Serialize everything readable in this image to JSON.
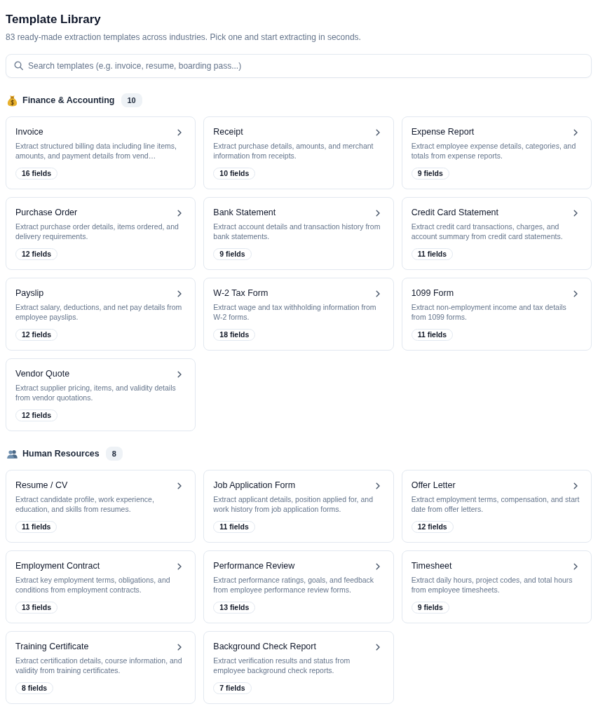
{
  "page": {
    "title": "Template Library",
    "subtitle": "83 ready-made extraction templates across industries. Pick one and start extracting in seconds."
  },
  "search": {
    "placeholder": "Search templates (e.g. invoice, resume, boarding pass...)"
  },
  "sections": [
    {
      "kind": "finance",
      "title": "Finance & Accounting",
      "count": "10",
      "templates": [
        {
          "title": "Invoice",
          "description": "Extract structured billing data including line items, amounts, and payment details from vend…",
          "fields": "16 fields"
        },
        {
          "title": "Receipt",
          "description": "Extract purchase details, amounts, and merchant information from receipts.",
          "fields": "10 fields"
        },
        {
          "title": "Expense Report",
          "description": "Extract employee expense details, categories, and totals from expense reports.",
          "fields": "9 fields"
        },
        {
          "title": "Purchase Order",
          "description": "Extract purchase order details, items ordered, and delivery requirements.",
          "fields": "12 fields"
        },
        {
          "title": "Bank Statement",
          "description": "Extract account details and transaction history from bank statements.",
          "fields": "9 fields"
        },
        {
          "title": "Credit Card Statement",
          "description": "Extract credit card transactions, charges, and account summary from credit card statements.",
          "fields": "11 fields"
        },
        {
          "title": "Payslip",
          "description": "Extract salary, deductions, and net pay details from employee payslips.",
          "fields": "12 fields"
        },
        {
          "title": "W-2 Tax Form",
          "description": "Extract wage and tax withholding information from W-2 forms.",
          "fields": "18 fields"
        },
        {
          "title": "1099 Form",
          "description": "Extract non-employment income and tax details from 1099 forms.",
          "fields": "11 fields"
        },
        {
          "title": "Vendor Quote",
          "description": "Extract supplier pricing, items, and validity details from vendor quotations.",
          "fields": "12 fields"
        }
      ]
    },
    {
      "kind": "people",
      "title": "Human Resources",
      "count": "8",
      "templates": [
        {
          "title": "Resume / CV",
          "description": "Extract candidate profile, work experience, education, and skills from resumes.",
          "fields": "11 fields"
        },
        {
          "title": "Job Application Form",
          "description": "Extract applicant details, position applied for, and work history from job application forms.",
          "fields": "11 fields"
        },
        {
          "title": "Offer Letter",
          "description": "Extract employment terms, compensation, and start date from offer letters.",
          "fields": "12 fields"
        },
        {
          "title": "Employment Contract",
          "description": "Extract key employment terms, obligations, and conditions from employment contracts.",
          "fields": "13 fields"
        },
        {
          "title": "Performance Review",
          "description": "Extract performance ratings, goals, and feedback from employee performance review forms.",
          "fields": "13 fields"
        },
        {
          "title": "Timesheet",
          "description": "Extract daily hours, project codes, and total hours from employee timesheets.",
          "fields": "9 fields"
        },
        {
          "title": "Training Certificate",
          "description": "Extract certification details, course information, and validity from training certificates.",
          "fields": "8 fields"
        },
        {
          "title": "Background Check Report",
          "description": "Extract verification results and status from employee background check reports.",
          "fields": "7 fields"
        }
      ]
    }
  ]
}
